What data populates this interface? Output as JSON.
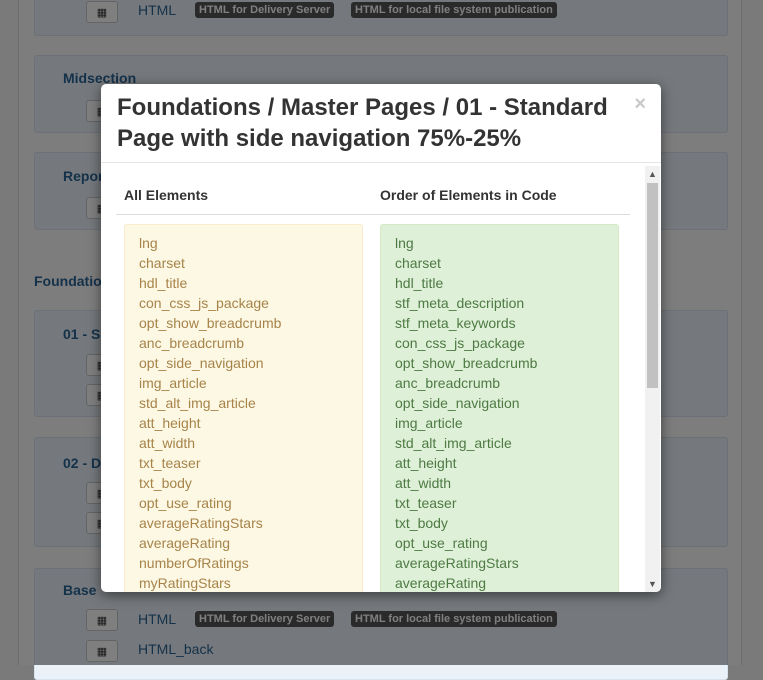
{
  "background": {
    "top_row": {
      "link": "HTML",
      "badges": [
        "HTML for Delivery Server",
        "HTML for local file system publication"
      ]
    },
    "panels": [
      {
        "title": "Midsection"
      },
      {
        "title": "Repor"
      },
      {
        "title": "01 - S"
      },
      {
        "title": "02 - D"
      },
      {
        "title": "Base"
      }
    ],
    "section_heading": "Foundatio",
    "bottom_rows": [
      {
        "link": "HTML",
        "badges": [
          "HTML for Delivery Server",
          "HTML for local file system publication"
        ]
      },
      {
        "link": "HTML_back"
      }
    ]
  },
  "modal": {
    "title": "Foundations / Master Pages / 01 - Standard Page with side navigation 75%-25%",
    "close_label": "×",
    "left_header": "All Elements",
    "right_header": "Order of Elements in Code",
    "all_elements": [
      "lng",
      "charset",
      "hdl_title",
      "con_css_js_package",
      "opt_show_breadcrumb",
      "anc_breadcrumb",
      "opt_side_navigation",
      "img_article",
      "std_alt_img_article",
      "att_height",
      "att_width",
      "txt_teaser",
      "txt_body",
      "opt_use_rating",
      "averageRatingStars",
      "averageRating",
      "numberOfRatings",
      "myRatingStars"
    ],
    "order_in_code": [
      "lng",
      "charset",
      "hdl_title",
      "stf_meta_description",
      "stf_meta_keywords",
      "con_css_js_package",
      "opt_show_breadcrumb",
      "anc_breadcrumb",
      "opt_side_navigation",
      "img_article",
      "std_alt_img_article",
      "att_height",
      "att_width",
      "txt_teaser",
      "txt_body",
      "opt_use_rating",
      "averageRatingStars",
      "averageRating"
    ],
    "scroll_up_icon": "▲",
    "scroll_down_icon": "▼"
  },
  "colors": {
    "left_well_bg": "#fcf8e3",
    "left_well_text": "#a7834a",
    "right_well_bg": "#dff0d8",
    "right_well_text": "#4d7a43",
    "link": "#2a6496",
    "badge_bg": "#555555"
  },
  "icons": {
    "grid_button": "grid-icon",
    "close": "close-icon"
  }
}
